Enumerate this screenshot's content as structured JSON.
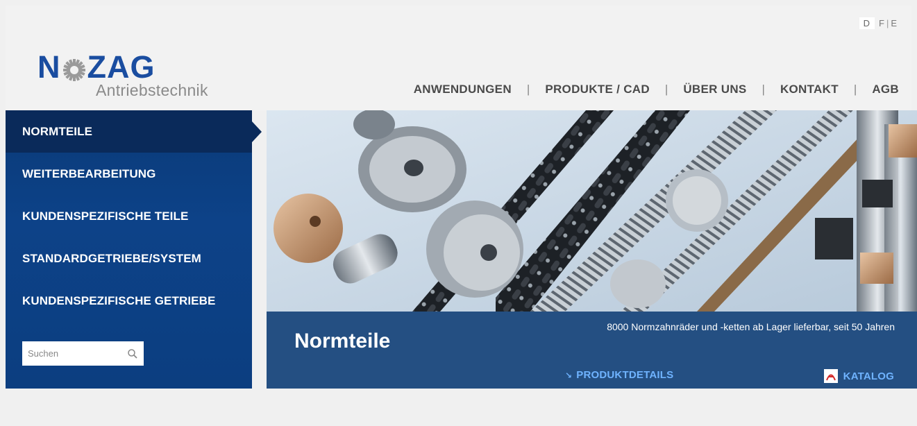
{
  "languages": {
    "active": "D",
    "items": [
      "F",
      "E"
    ],
    "separator": "|"
  },
  "logo": {
    "word_left": "N",
    "word_right": "ZAG",
    "subtitle": "Antriebstechnik"
  },
  "nav": {
    "items": [
      "ANWENDUNGEN",
      "PRODUKTE / CAD",
      "ÜBER UNS",
      "KONTAKT",
      "AGB"
    ],
    "separator": "|"
  },
  "sidebar": {
    "items": [
      {
        "label": "NORMTEILE",
        "active": true
      },
      {
        "label": "WEITERBEARBEITUNG",
        "active": false
      },
      {
        "label": "KUNDENSPEZIFISCHE TEILE",
        "active": false
      },
      {
        "label": "STANDARDGETRIEBE/SYSTEM",
        "active": false
      },
      {
        "label": "KUNDENSPEZIFISCHE GETRIEBE",
        "active": false
      }
    ],
    "search_placeholder": "Suchen"
  },
  "hero": {
    "title": "Normteile",
    "description": "8000 Normzahnräder und -ketten ab Lager lieferbar, seit 50 Jahren",
    "link_details": "PRODUKTDETAILS",
    "link_katalog": "KATALOG",
    "image_icon": "gears-photo"
  },
  "colors": {
    "brand_blue": "#1a4da0",
    "sidebar_blue": "#0d4288",
    "active_item": "#0a2a5a",
    "caption_bg": "#244f82",
    "link_blue": "#6fb3ff"
  }
}
